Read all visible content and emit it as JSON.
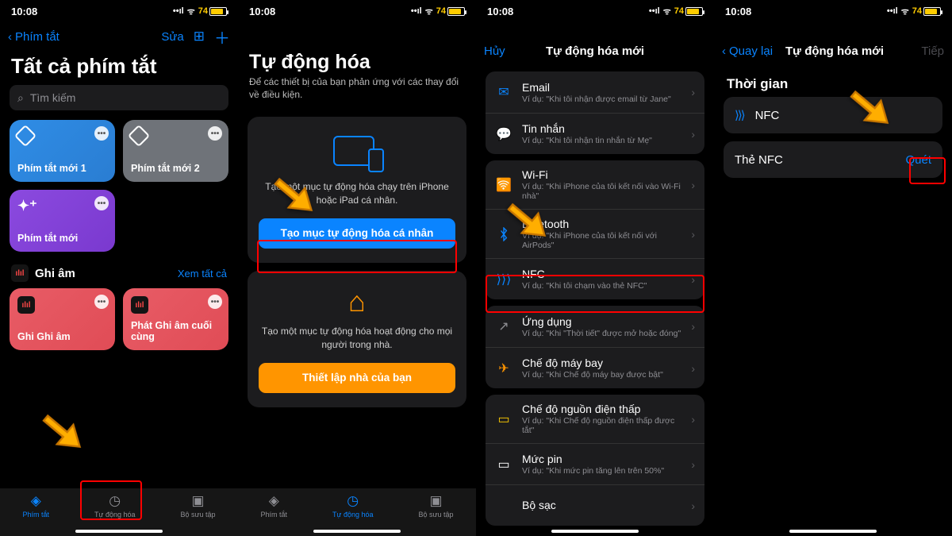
{
  "status": {
    "time": "10:08",
    "battery": "74"
  },
  "p1": {
    "nav_back": "Phím tắt",
    "nav_edit": "Sửa",
    "title": "Tất cả phím tắt",
    "search_placeholder": "Tìm kiếm",
    "tiles": [
      {
        "label": "Phím tắt mới 1"
      },
      {
        "label": "Phím tắt mới 2"
      },
      {
        "label": "Phím tắt mới"
      }
    ],
    "section_name": "Ghi âm",
    "section_link": "Xem tất cả",
    "rec_tiles": [
      {
        "label": "Ghi Ghi âm"
      },
      {
        "label": "Phát Ghi âm cuối cùng"
      }
    ],
    "tabs": {
      "shortcuts": "Phím tắt",
      "automation": "Tự động hóa",
      "gallery": "Bộ sưu tập"
    }
  },
  "p2": {
    "title": "Tự động hóa",
    "subtitle": "Để các thiết bị của bạn phản ứng với các thay đổi về điều kiện.",
    "card1_text": "Tạo một mục tự động hóa chạy trên iPhone hoặc iPad cá nhân.",
    "card1_btn": "Tạo mục tự động hóa cá nhân",
    "card2_text": "Tạo một mục tự động hóa hoạt động cho mọi người trong nhà.",
    "card2_btn": "Thiết lập nhà của bạn"
  },
  "p3": {
    "nav_cancel": "Hủy",
    "nav_title": "Tự động hóa mới",
    "rows_a": [
      {
        "icon": "✉︎",
        "color": "#0a84ff",
        "t": "Email",
        "d": "Ví dụ: \"Khi tôi nhận được email từ Jane\""
      },
      {
        "icon": "💬",
        "color": "#30d158",
        "t": "Tin nhắn",
        "d": "Ví dụ: \"Khi tôi nhận tin nhắn từ Mẹ\""
      }
    ],
    "rows_b": [
      {
        "icon": "🛜",
        "color": "#0a84ff",
        "t": "Wi-Fi",
        "d": "Ví dụ: \"Khi iPhone của tôi kết nối vào Wi-Fi nhà\""
      },
      {
        "icon": "⌵",
        "color": "#0a84ff",
        "t": "Bluetooth",
        "d": "Ví dụ: \"Khi iPhone của tôi kết nối với AirPods\"",
        "bt": true
      },
      {
        "icon": "⟩⟩⟩",
        "color": "#0a84ff",
        "t": "NFC",
        "d": "Ví dụ: \"Khi tôi chạm vào thẻ NFC\""
      }
    ],
    "rows_c": [
      {
        "icon": "↗",
        "color": "#8e8e93",
        "t": "Ứng dụng",
        "d": "Ví dụ: \"Khi \"Thời tiết\" được mở hoặc đóng\""
      },
      {
        "icon": "✈",
        "color": "#ff9500",
        "t": "Chế độ máy bay",
        "d": "Ví dụ: \"Khi Chế độ máy bay được bật\""
      }
    ],
    "rows_d": [
      {
        "icon": "▭",
        "color": "#ffcc00",
        "t": "Chế độ nguồn điện thấp",
        "d": "Ví dụ: \"Khi Chế độ nguồn điện thấp được tắt\""
      },
      {
        "icon": "▭",
        "color": "#fff",
        "t": "Mức pin",
        "d": "Ví dụ: \"Khi mức pin tăng lên trên 50%\""
      },
      {
        "icon": "",
        "color": "#30d158",
        "t": "Bộ sạc",
        "d": ""
      }
    ]
  },
  "p4": {
    "nav_back": "Quay lại",
    "nav_title": "Tự động hóa mới",
    "nav_next": "Tiếp",
    "section": "Thời gian",
    "nfc_label": "NFC",
    "tag_label": "Thẻ NFC",
    "scan_label": "Quét"
  }
}
